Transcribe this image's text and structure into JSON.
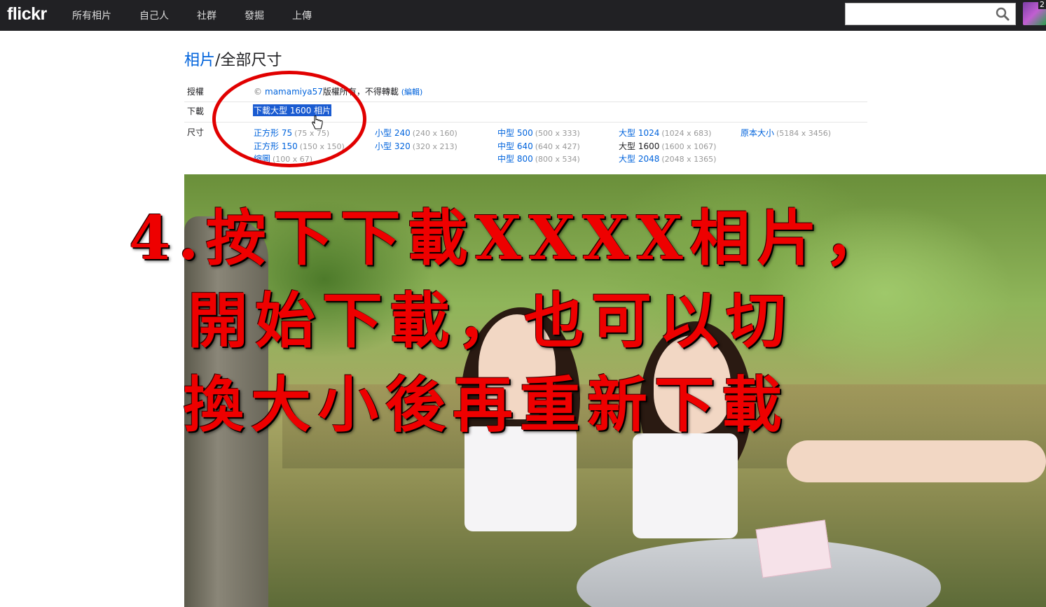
{
  "nav": {
    "logo": "flickr",
    "items": [
      "所有相片",
      "自己人",
      "社群",
      "發掘",
      "上傳"
    ],
    "search_value": "",
    "notification_count": "2"
  },
  "breadcrumb": {
    "link": "相片",
    "separator": "/",
    "current": "全部尺寸"
  },
  "license": {
    "label": "授權",
    "cc_symbol": "©",
    "owner": "mamamiya57",
    "text": "版權所有，不得轉載",
    "edit": "(編輯)"
  },
  "download": {
    "label": "下載",
    "link": "下載大型 1600 相片"
  },
  "sizes": {
    "label": "尺寸",
    "items": [
      {
        "name": "正方形 75",
        "dim": "(75 x 75)"
      },
      {
        "name": "正方形 150",
        "dim": "(150 x 150)"
      },
      {
        "name": "縮圖",
        "dim": "(100 x 67)"
      },
      {
        "name": "小型 240",
        "dim": "(240 x 160)"
      },
      {
        "name": "小型 320",
        "dim": "(320 x 213)"
      },
      {
        "name": "中型 500",
        "dim": "(500 x 333)"
      },
      {
        "name": "中型 640",
        "dim": "(640 x 427)"
      },
      {
        "name": "中型 800",
        "dim": "(800 x 534)"
      },
      {
        "name": "大型 1024",
        "dim": "(1024 x 683)"
      },
      {
        "name": "大型 1600",
        "dim": "(1600 x 1067)"
      },
      {
        "name": "大型 2048",
        "dim": "(2048 x 1365)"
      },
      {
        "name": "原本大小",
        "dim": "(5184 x 3456)"
      }
    ]
  },
  "caption": {
    "line1": "4.按下下載XXXX相片，",
    "line2": "開始下載，也可以切",
    "line3": "換大小後再重新下載"
  },
  "colors": {
    "nav_bg": "#212124",
    "link": "#0063dc",
    "highlight": "#1a5bd1",
    "caption": "#ee0000"
  }
}
